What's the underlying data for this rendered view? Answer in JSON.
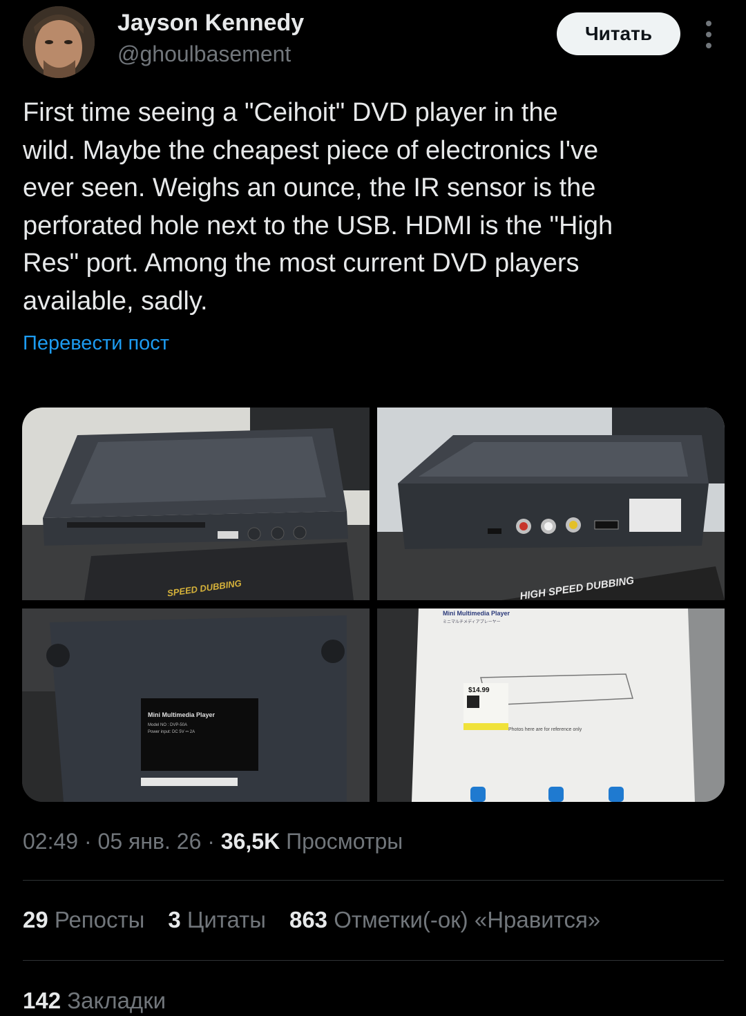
{
  "author": {
    "name": "Jayson Kennedy",
    "handle": "@ghoulbasement",
    "follow_label": "Читать"
  },
  "tweet": {
    "text": "First time seeing a \"Ceihoit\" DVD player in the\nwild. Maybe the cheapest piece of electronics I've\never seen. Weighs an ounce, the IR sensor is the\nperforated hole next to the USB. HDMI is the \"High\nRes\" port. Among the most current DVD players\navailable, sadly.",
    "translate_label": "Перевести пост"
  },
  "media": {
    "img1_caption": "SPEED DUBBING",
    "img2_caption": "HIGH SPEED DUBBING",
    "img3_label_title": "Mini Multimedia Player",
    "img3_label_lines": [
      "Model NO : DVP-50A",
      "Power input: DC 5V ⎓ 2A"
    ],
    "img4_box_title": "Mini Multimedia Player",
    "img4_box_subtitle": "ミニマルチメディアプレーヤー",
    "img4_price": "$14.99",
    "img4_disclaimer": "Photos here are for reference only"
  },
  "meta": {
    "time": "02:49",
    "date": "05 янв. 26",
    "views_count": "36,5K",
    "views_label": "Просмотры"
  },
  "stats": {
    "reposts_count": "29",
    "reposts_label": "Репосты",
    "quotes_count": "3",
    "quotes_label": "Цитаты",
    "likes_count": "863",
    "likes_label": "Отметки(-ок) «Нравится»",
    "bookmarks_count": "142",
    "bookmarks_label": "Закладки"
  },
  "colors": {
    "background": "#000000",
    "text": "#e7e9ea",
    "secondary": "#71767b",
    "link": "#1d9bf0",
    "divider": "#2f3336"
  }
}
